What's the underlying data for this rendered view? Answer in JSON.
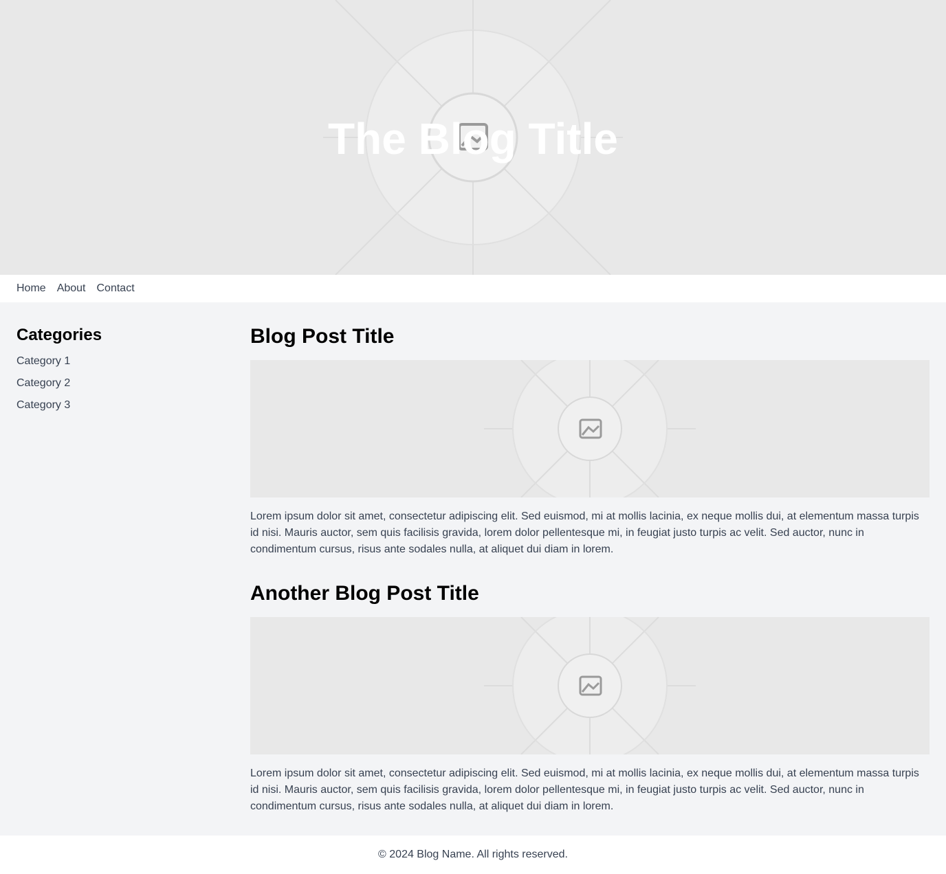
{
  "hero": {
    "title": "The Blog Title",
    "image_icon": "image-placeholder-icon"
  },
  "nav": {
    "items": [
      "Home",
      "About",
      "Contact"
    ]
  },
  "sidebar": {
    "heading": "Categories",
    "items": [
      "Category 1",
      "Category 2",
      "Category 3"
    ]
  },
  "posts": [
    {
      "title": "Blog Post Title",
      "image_icon": "image-placeholder-icon",
      "body": "Lorem ipsum dolor sit amet, consectetur adipiscing elit. Sed euismod, mi at mollis lacinia, ex neque mollis dui, at elementum massa turpis id nisi. Mauris auctor, sem quis facilisis gravida, lorem dolor pellentesque mi, in feugiat justo turpis ac velit. Sed auctor, nunc in condimentum cursus, risus ante sodales nulla, at aliquet dui diam in lorem."
    },
    {
      "title": "Another Blog Post Title",
      "image_icon": "image-placeholder-icon",
      "body": "Lorem ipsum dolor sit amet, consectetur adipiscing elit. Sed euismod, mi at mollis lacinia, ex neque mollis dui, at elementum massa turpis id nisi. Mauris auctor, sem quis facilisis gravida, lorem dolor pellentesque mi, in feugiat justo turpis ac velit. Sed auctor, nunc in condimentum cursus, risus ante sodales nulla, at aliquet dui diam in lorem."
    }
  ],
  "footer": {
    "text": "© 2024 Blog Name. All rights reserved."
  },
  "colors": {
    "page_bg": "#f3f4f6",
    "placeholder_bg": "#e8e8e8",
    "text_muted": "#374151"
  }
}
